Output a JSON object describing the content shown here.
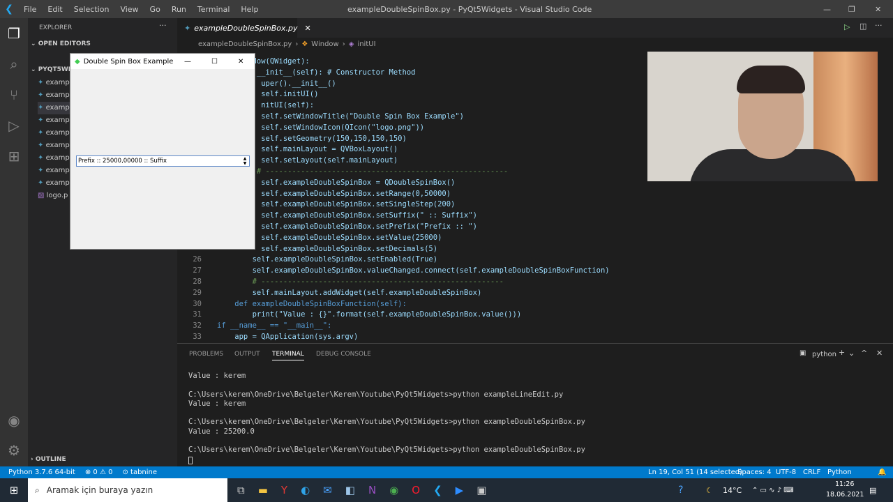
{
  "window_title": "exampleDoubleSpinBox.py - PyQt5Widgets - Visual Studio Code",
  "menu": [
    "File",
    "Edit",
    "Selection",
    "View",
    "Go",
    "Run",
    "Terminal",
    "Help"
  ],
  "explorer": {
    "header": "EXPLORER",
    "open_editors": "OPEN EDITORS",
    "project": "PYQT5WIDGETS",
    "files": [
      "examp",
      "examp",
      "examp",
      "examp",
      "examp",
      "examp",
      "examp",
      "examp",
      "examp",
      "logo.p"
    ],
    "outline": "OUTLINE"
  },
  "tab": {
    "label": "exampleDoubleSpinBox.py"
  },
  "breadcrumb": [
    "exampleDoubleSpinBox.py",
    "Window",
    "initUI"
  ],
  "code_lines": [
    {
      "n": "",
      "t": "        dow(QWidget):"
    },
    {
      "n": "",
      "t": "         __init__(self): # Constructor Method"
    },
    {
      "n": "",
      "t": "          uper().__init__()"
    },
    {
      "n": "",
      "t": "          self.initUI()"
    },
    {
      "n": "",
      "t": "          nitUI(self):"
    },
    {
      "n": "",
      "t": "          self.setWindowTitle(\"Double Spin Box Example\")"
    },
    {
      "n": "",
      "t": "          self.setWindowIcon(QIcon(\"logo.png\"))"
    },
    {
      "n": "",
      "t": "          self.setGeometry(150,150,150,150)"
    },
    {
      "n": "",
      "t": "          self.mainLayout = QVBoxLayout()"
    },
    {
      "n": "",
      "t": "          self.setLayout(self.mainLayout)"
    },
    {
      "n": "",
      "t": "         # -------------------------------------------------------"
    },
    {
      "n": "",
      "t": "          self.exampleDoubleSpinBox = QDoubleSpinBox()"
    },
    {
      "n": "",
      "t": "          self.exampleDoubleSpinBox.setRange(0,50000)"
    },
    {
      "n": "",
      "t": "          self.exampleDoubleSpinBox.setSingleStep(200)"
    },
    {
      "n": "",
      "t": "          self.exampleDoubleSpinBox.setSuffix(\" :: Suffix\")"
    },
    {
      "n": "",
      "t": "          self.exampleDoubleSpinBox.setPrefix(\"Prefix :: \")"
    },
    {
      "n": "",
      "t": "          self.exampleDoubleSpinBox.setValue(25000)"
    },
    {
      "n": "",
      "t": "          self.exampleDoubleSpinBox.setDecimals(5)"
    },
    {
      "n": "26",
      "t": "        self.exampleDoubleSpinBox.setEnabled(True)"
    },
    {
      "n": "27",
      "t": "        self.exampleDoubleSpinBox.valueChanged.connect(self.exampleDoubleSpinBoxFunction)"
    },
    {
      "n": "28",
      "t": "        # -------------------------------------------------------"
    },
    {
      "n": "29",
      "t": "        self.mainLayout.addWidget(self.exampleDoubleSpinBox)"
    },
    {
      "n": "30",
      "t": "    def exampleDoubleSpinBoxFunction(self):"
    },
    {
      "n": "31",
      "t": "        print(\"Value : {}\".format(self.exampleDoubleSpinBox.value()))"
    },
    {
      "n": "32",
      "t": "if __name__ == \"__main__\":"
    },
    {
      "n": "33",
      "t": "    app = QApplication(sys.argv)"
    }
  ],
  "panel_tabs": [
    "PROBLEMS",
    "OUTPUT",
    "TERMINAL",
    "DEBUG CONSOLE"
  ],
  "terminal_shell": "python",
  "terminal_text": "Value : kerem\n\nC:\\Users\\kerem\\OneDrive\\Belgeler\\Kerem\\Youtube\\PyQt5Widgets>python exampleLineEdit.py\nValue : kerem\n\nC:\\Users\\kerem\\OneDrive\\Belgeler\\Kerem\\Youtube\\PyQt5Widgets>python exampleDoubleSpinBox.py\nValue : 25200.0\n\nC:\\Users\\kerem\\OneDrive\\Belgeler\\Kerem\\Youtube\\PyQt5Widgets>python exampleDoubleSpinBox.py",
  "status": {
    "python": "Python 3.7.6 64-bit",
    "problems": "⊗ 0 ⚠ 0",
    "tabnine": "tabnine",
    "position": "Ln 19, Col 51 (14 selected)",
    "spaces": "Spaces: 4",
    "encoding": "UTF-8",
    "eol": "CRLF",
    "lang": "Python"
  },
  "qt_window": {
    "title": "Double Spin Box Example",
    "spinbox_value": "Prefix :: 25000,00000 :: Suffix"
  },
  "taskbar": {
    "search_placeholder": "Aramak için buraya yazın",
    "temp": "14°C",
    "time": "11:26",
    "date": "18.06.2021"
  },
  "colors": {
    "accent": "#007acc",
    "keyword": "#569cd6",
    "string": "#ce9178",
    "comment": "#6a9955",
    "class": "#4ec9b0"
  }
}
